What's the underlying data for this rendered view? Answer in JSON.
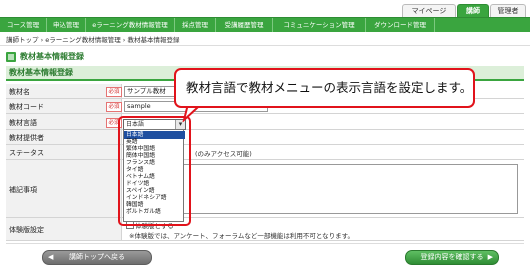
{
  "top_tabs": {
    "mypage": "マイページ",
    "lecturer": "講師",
    "admin": "管理者"
  },
  "nav": {
    "items": [
      "コース管理",
      "申込管理",
      "eラーニング教材情報管理",
      "採点管理",
      "受講履歴管理",
      "コミュニケーション管理",
      "ダウンロード管理"
    ]
  },
  "breadcrumb": "講師トップ › eラーニング教材情報管理 › 教材基本情報登録",
  "page_title": "教材基本情報登録",
  "section_title": "教材基本情報登録",
  "form": {
    "required_badge": "必須",
    "material_name": {
      "label": "教材名",
      "value": "サンプル教材"
    },
    "material_code": {
      "label": "教材コード",
      "value": "sample"
    },
    "material_language": {
      "label": "教材言語",
      "selected": "日本語"
    },
    "material_provider": {
      "label": "教材提供者"
    },
    "status": {
      "label": "ステータス",
      "partial_text": "(のみアクセス可能)"
    },
    "notes": {
      "label": "補記事項"
    },
    "trial": {
      "label": "体験版設定",
      "checkbox_label": "体験版とする",
      "note": "※体験版では、アンケート、フォーラムなど一部機能は利用不可となります。"
    }
  },
  "language_options": [
    "日本語",
    "英語",
    "繁体中国語",
    "簡体中国語",
    "フランス語",
    "タイ語",
    "ベトナム語",
    "ドイツ語",
    "スペイン語",
    "インドネシア語",
    "韓国語",
    "ポルトガル語"
  ],
  "callout": "教材言語で教材メニューの表示言語を設定します。",
  "buttons": {
    "back": "講師トップへ戻る",
    "confirm": "登録内容を確認する"
  },
  "colors": {
    "brand_green": "#3aa53f",
    "highlight_red": "#e1131b",
    "selected_option": "#1f4fa0"
  }
}
